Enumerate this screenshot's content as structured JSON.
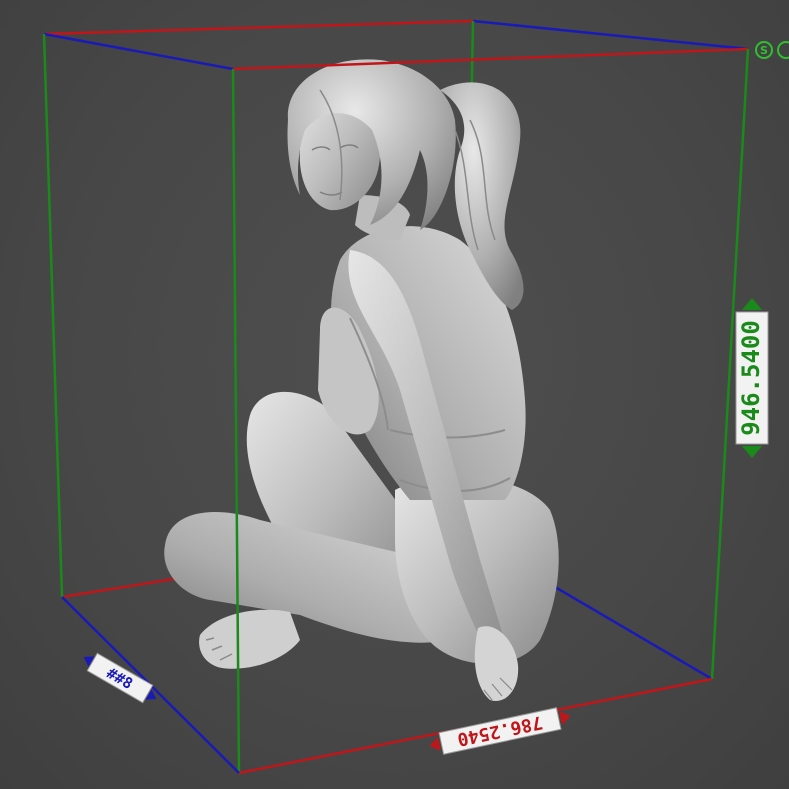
{
  "scene": {
    "dimensions": {
      "height_label": "946.5400",
      "width_label": "786.2540",
      "depth_label": "##8"
    },
    "axes": {
      "x_color": "#c0161a",
      "y_color": "#1a1ab8",
      "z_color": "#1a8a1a"
    },
    "corner_markers": [
      "S",
      "C"
    ],
    "model": {
      "fill": "#b8b8b8",
      "shade": "#8e8e8e",
      "highlight": "#e2e2e2"
    }
  }
}
